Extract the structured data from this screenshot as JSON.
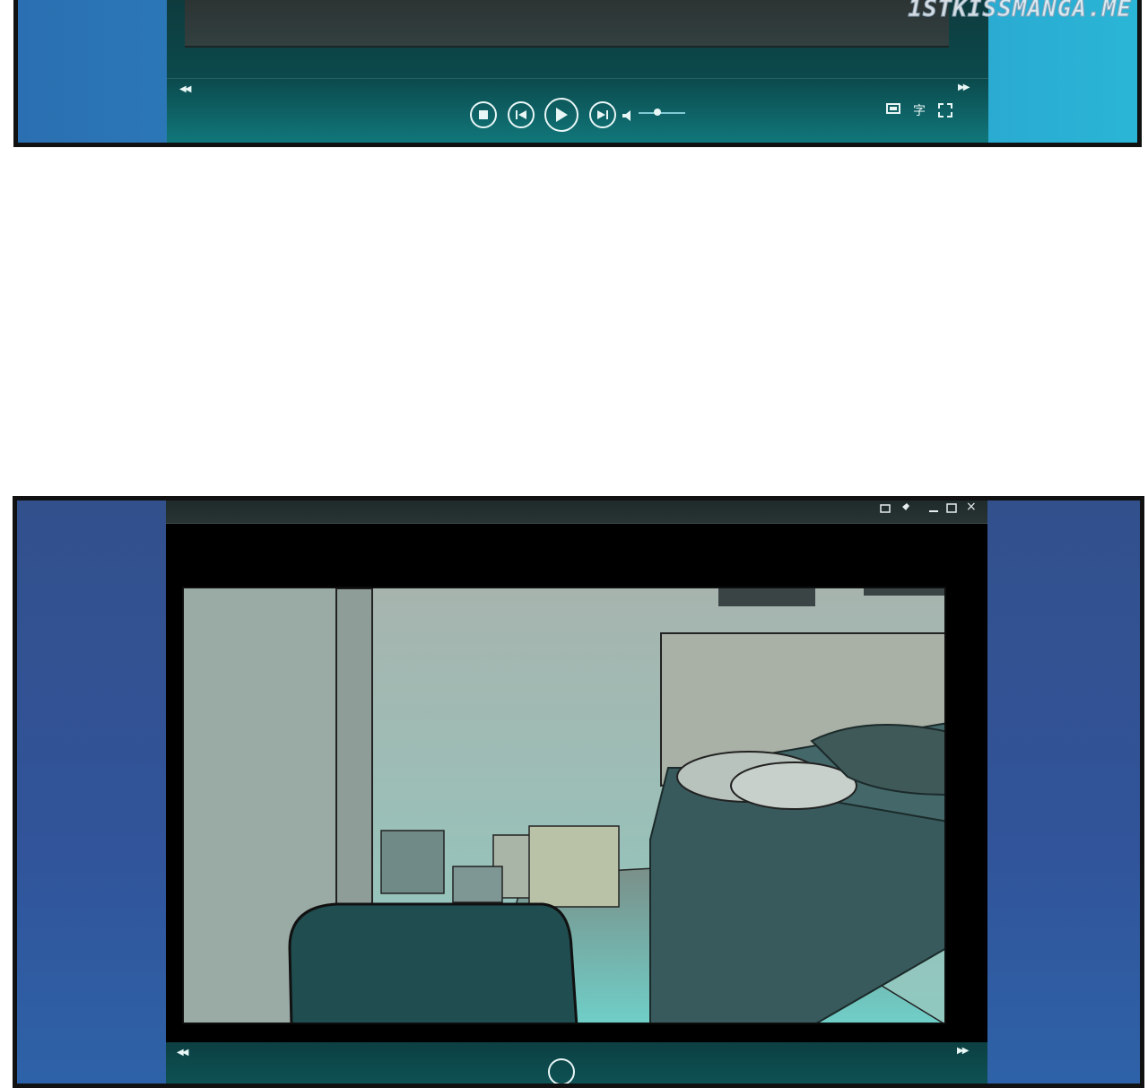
{
  "watermark": {
    "text": "1STKISSMANGA.ME"
  },
  "top_player": {
    "rewind_icon": "rewind-icon",
    "fast_forward_icon": "fast-forward-icon",
    "controls": [
      "stop-icon",
      "previous-icon",
      "play-icon",
      "next-icon",
      "volume-icon"
    ],
    "volume_level": 0.4,
    "right_tools": {
      "screen_icon": "screen-icon",
      "subtitle_glyph": "字",
      "fullscreen_icon": "fullscreen-icon"
    }
  },
  "bottom_player": {
    "title_bar_icons": [
      "window-icon",
      "pin-icon",
      "minimize-icon",
      "maximize-icon",
      "close-icon"
    ],
    "close_glyph": "×",
    "scene": "bedroom",
    "rewind_icon": "rewind-icon",
    "fast_forward_icon": "fast-forward-icon"
  },
  "colors": {
    "panel_blue_top": "#2d86c4",
    "panel_blue_bottom": "#31549a",
    "player_teal": "#0b4a4d",
    "control_white": "#e9f6f6"
  }
}
